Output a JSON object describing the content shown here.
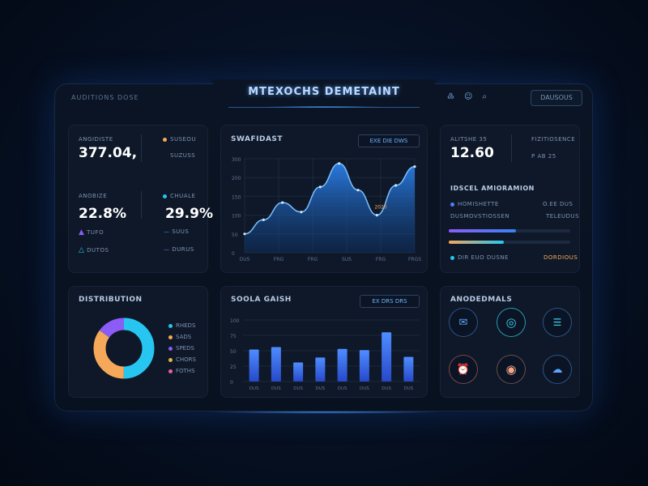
{
  "header": {
    "title": "MTEXOCHS DEMETAINT",
    "left_label": "AUDITIONS DOSE",
    "icons": [
      "bell-icon",
      "user-icon",
      "search-icon"
    ],
    "icon_glyphs": [
      "♴",
      "☺",
      "⌕"
    ],
    "button_label": "DAUSOUS"
  },
  "stats_panel": {
    "metric1_label": "ANGIDISTE",
    "metric1_value": "377.04,",
    "metric1_side": "SUSEOU",
    "metric1_side2": "SUZUSS",
    "metric2_label": "ANOBIZE",
    "metric2_value": "22.8%",
    "metric2_side_label": "CHUALE",
    "metric2_side_value": "29.9%",
    "list": [
      {
        "icon": "triangle-icon",
        "label": "TUFO",
        "value": "SUUS"
      },
      {
        "icon": "network-icon",
        "label": "DUTOS",
        "value": "DURUS"
      }
    ]
  },
  "line_panel": {
    "title": "SWAFIDAST",
    "controls": [
      "EXE",
      "DIE",
      "DWS"
    ],
    "y_ticks": [
      "300",
      "200",
      "150",
      "100",
      "50",
      "0"
    ],
    "x_ticks": [
      "DUS",
      "FRG",
      "FRG",
      "SUS",
      "FRG",
      "FRGS"
    ],
    "tooltip": "2020"
  },
  "right_stat_panel": {
    "label": "ALITSHE 35",
    "value": "12.60",
    "side_label": "FIZITIOSENCE",
    "side_value": "P AB 25",
    "section_title": "IDSCEL AMIORAMION",
    "rows": [
      {
        "label": "HOMISHETTE",
        "value": "O.EE DUS"
      },
      {
        "label": "DUSMOVSTIOSSEN",
        "value": "TELEUDUS"
      }
    ],
    "progress": [
      0.55,
      0.45
    ],
    "footer_label": "DIR EUO DUSNE",
    "footer_value": "DORDIOUS"
  },
  "donut_panel": {
    "title": "DISTRIBUTION",
    "legend": [
      {
        "label": "RHEDS",
        "color": "#26c6f0"
      },
      {
        "label": "SADS",
        "color": "#f5a85a"
      },
      {
        "label": "SPEDS",
        "color": "#8b5cf6"
      },
      {
        "label": "CHORS",
        "color": "#e2b54a"
      },
      {
        "label": "FOTHS",
        "color": "#ec5fa2"
      }
    ],
    "segments": [
      {
        "value": 50,
        "color": "#26c6f0"
      },
      {
        "value": 35,
        "color": "#f5a85a"
      },
      {
        "value": 15,
        "color": "#8b5cf6"
      }
    ]
  },
  "bar_panel": {
    "title": "SOOLA GAISH",
    "controls": [
      "EX",
      "DRS",
      "DRS"
    ],
    "y_ticks": [
      "100",
      "75",
      "50",
      "25",
      "0"
    ],
    "x_ticks": [
      "DUS",
      "DUS",
      "DUS",
      "DUS",
      "DUS",
      "DUS",
      "DUS",
      "DUS"
    ]
  },
  "icons_panel": {
    "title": "ANODEDMALS",
    "buttons": [
      {
        "icon": "chat-icon",
        "glyph": "✉",
        "color": "#5aa7ff"
      },
      {
        "icon": "ring-icon",
        "glyph": "◎",
        "color": "#37d2f0"
      },
      {
        "icon": "message-icon",
        "glyph": "☰",
        "color": "#37d2f0"
      },
      {
        "icon": "alarm-icon",
        "glyph": "⏰",
        "color": "#f07a6a"
      },
      {
        "icon": "target-icon",
        "glyph": "◉",
        "color": "#f5a68a"
      },
      {
        "icon": "cloud-icon",
        "glyph": "☁",
        "color": "#5aa7ff"
      }
    ]
  },
  "chart_data": [
    {
      "type": "area",
      "title": "SWAFIDAST",
      "x": [
        "DUS",
        "FRG",
        "FRG",
        "SUS",
        "FRG",
        "FRGS"
      ],
      "y_ticks": [
        "300",
        "200",
        "150",
        "100",
        "50",
        "0"
      ],
      "ylim": [
        0,
        300
      ],
      "series": [
        {
          "values": [
            60,
            105,
            160,
            130,
            210,
            285,
            200,
            120,
            215,
            275
          ]
        }
      ]
    },
    {
      "type": "bar",
      "title": "SOOLA GAISH",
      "categories": [
        "DUS",
        "DUS",
        "DUS",
        "DUS",
        "DUS",
        "DUS",
        "DUS",
        "DUS"
      ],
      "ylim": [
        0,
        100
      ],
      "values": [
        52,
        56,
        31,
        39,
        53,
        51,
        80,
        40
      ]
    }
  ]
}
